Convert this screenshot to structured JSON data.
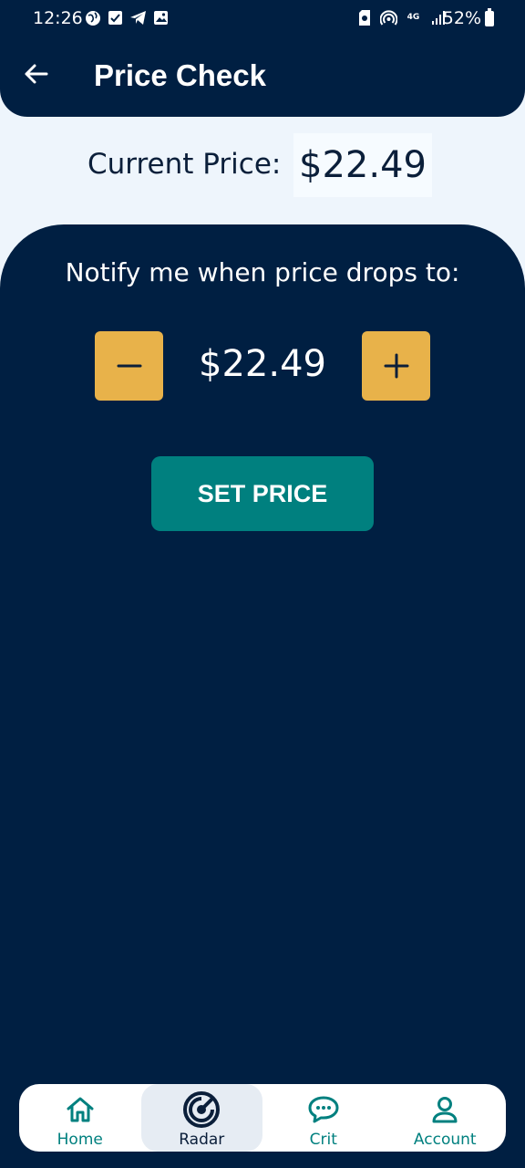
{
  "status_bar": {
    "time": "12:26",
    "battery": "52%",
    "network": "4G",
    "left_icons": [
      "globe-icon",
      "check-square-icon",
      "telegram-icon",
      "image-icon"
    ],
    "right_icons": [
      "sim-icon",
      "hotspot-icon",
      "network-4g-icon",
      "signal-icon",
      "battery-icon"
    ]
  },
  "header": {
    "title": "Price Check",
    "back_icon": "arrow-left-icon"
  },
  "current_price": {
    "label": "Current Price:",
    "value": "$22.49"
  },
  "notify": {
    "label": "Notify me when price drops to:",
    "target_value": "$22.49",
    "decrement_icon": "minus-icon",
    "increment_icon": "plus-icon",
    "set_button_label": "SET PRICE"
  },
  "bottom_nav": {
    "items": [
      {
        "label": "Home",
        "icon": "home-icon",
        "active": false
      },
      {
        "label": "Radar",
        "icon": "radar-icon",
        "active": true
      },
      {
        "label": "Crit",
        "icon": "chat-icon",
        "active": false
      },
      {
        "label": "Account",
        "icon": "user-icon",
        "active": false
      }
    ]
  },
  "colors": {
    "navy": "#001f42",
    "background": "#eef5fc",
    "accent_yellow": "#e8b24a",
    "teal": "#00807f",
    "nav_active_bg": "#e6ecf3"
  }
}
